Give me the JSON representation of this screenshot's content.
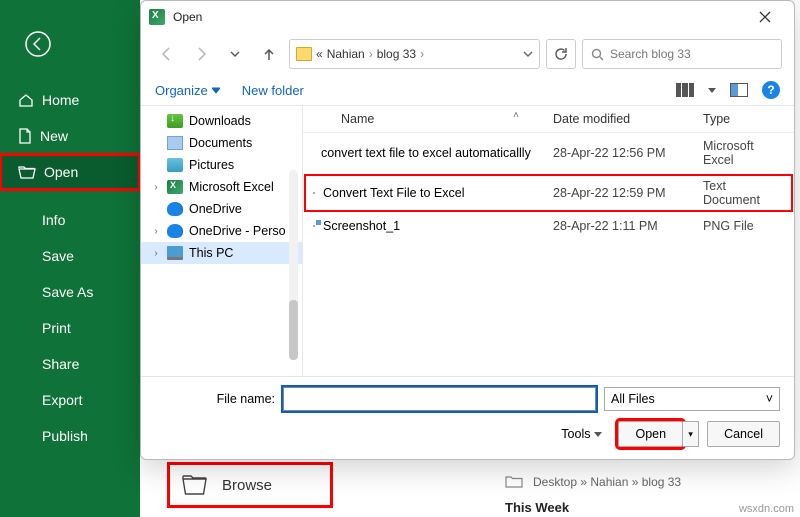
{
  "backstage": {
    "items": [
      {
        "label": "Home",
        "icon": "home-icon"
      },
      {
        "label": "New",
        "icon": "new-icon"
      },
      {
        "label": "Open",
        "icon": "open-icon"
      },
      {
        "label": "Info"
      },
      {
        "label": "Save"
      },
      {
        "label": "Save As"
      },
      {
        "label": "Print"
      },
      {
        "label": "Share"
      },
      {
        "label": "Export"
      },
      {
        "label": "Publish"
      }
    ],
    "browse_label": "Browse",
    "recent_path": "Desktop » Nahian » blog 33",
    "recent_group": "This Week"
  },
  "dialog": {
    "title": "Open",
    "breadcrumb": {
      "chevron": "«",
      "parts": [
        "Nahian",
        "blog 33"
      ]
    },
    "search_placeholder": "Search blog 33",
    "toolbar": {
      "organize": "Organize",
      "newfolder": "New folder",
      "help": "?"
    },
    "tree": [
      {
        "label": "Downloads",
        "iconcls": "ic-dl",
        "exp": ""
      },
      {
        "label": "Documents",
        "iconcls": "ic-doc",
        "exp": ""
      },
      {
        "label": "Pictures",
        "iconcls": "ic-pic",
        "exp": ""
      },
      {
        "label": "Microsoft Excel",
        "iconcls": "ic-xl",
        "exp": "›"
      },
      {
        "label": "OneDrive",
        "iconcls": "ic-od",
        "exp": ""
      },
      {
        "label": "OneDrive - Perso",
        "iconcls": "ic-od",
        "exp": "›"
      },
      {
        "label": "This PC",
        "iconcls": "ic-pc",
        "exp": "›",
        "sel": true
      }
    ],
    "columns": {
      "name": "Name",
      "date": "Date modified",
      "type": "Type"
    },
    "files": [
      {
        "name": "convert text file to excel automaticallly",
        "date": "28-Apr-22 12:56 PM",
        "type": "Microsoft Excel",
        "iconcls": "ic-xl"
      },
      {
        "name": "Convert Text File to Excel",
        "date": "28-Apr-22 12:59 PM",
        "type": "Text Document",
        "iconcls": "ic-txt",
        "hl": true
      },
      {
        "name": "Screenshot_1",
        "date": "28-Apr-22 1:11 PM",
        "type": "PNG File",
        "iconcls": "ic-png"
      }
    ],
    "filename_label": "File name:",
    "filename_value": "",
    "filter": "All Files",
    "tools_label": "Tools",
    "open_btn": "Open",
    "cancel_btn": "Cancel"
  },
  "watermark": "wsxdn.com"
}
